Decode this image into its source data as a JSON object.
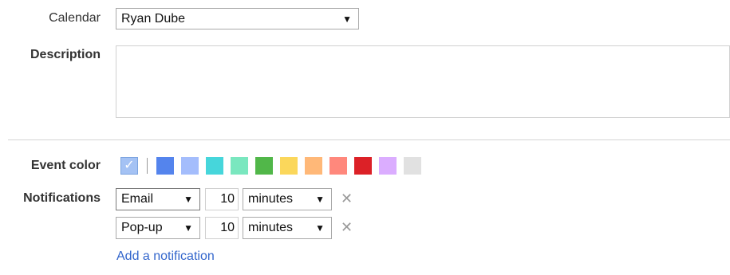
{
  "calendar": {
    "label": "Calendar",
    "value": "Ryan Dube"
  },
  "description": {
    "label": "Description",
    "value": ""
  },
  "event_color": {
    "label": "Event color",
    "default_checked": true,
    "colors": [
      "#5484ed",
      "#a4bdfc",
      "#46d6db",
      "#7ae7bf",
      "#51b749",
      "#fbd75b",
      "#ffb878",
      "#ff887c",
      "#dc2127",
      "#dbadff",
      "#e1e1e1"
    ]
  },
  "notifications": {
    "label": "Notifications",
    "items": [
      {
        "method": "Email",
        "amount": "10",
        "unit": "minutes"
      },
      {
        "method": "Pop-up",
        "amount": "10",
        "unit": "minutes"
      }
    ],
    "add_label": "Add a notification"
  },
  "icons": {
    "caret": "▼",
    "remove": "✕",
    "check": "✓"
  }
}
